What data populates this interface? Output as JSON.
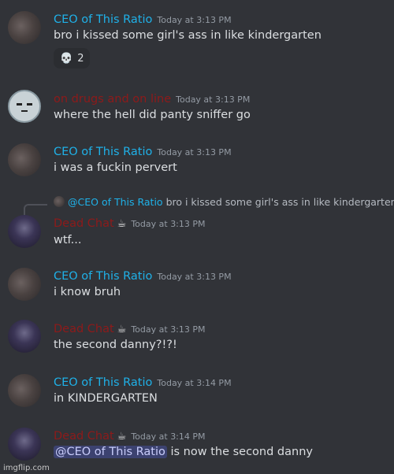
{
  "messages": [
    {
      "author": "CEO of This Ratio",
      "time": "Today at 3:13 PM",
      "text": "bro i kissed some girl's ass in like kindergarten",
      "reaction": {
        "emoji": "💀",
        "count": "2"
      }
    },
    {
      "author": "on drugs and on line",
      "time": "Today at 3:13 PM",
      "text": "where the hell did panty sniffer go"
    },
    {
      "author": "CEO of This Ratio",
      "time": "Today at 3:13 PM",
      "text": "i was a fuckin pervert"
    },
    {
      "author": "Dead Chat",
      "badge": "☕",
      "time": "Today at 3:13 PM",
      "text": "wtf...",
      "reply": {
        "author": "@CEO of This Ratio",
        "text": "bro i kissed some girl's ass in like kindergarten"
      }
    },
    {
      "author": "CEO of This Ratio",
      "time": "Today at 3:13 PM",
      "text": "i know bruh"
    },
    {
      "author": "Dead Chat",
      "badge": "☕",
      "time": "Today at 3:13 PM",
      "text": "the second danny?!?!"
    },
    {
      "author": "CEO of This Ratio",
      "time": "Today at 3:14 PM",
      "text": "in KINDERGARTEN"
    },
    {
      "author": "Dead Chat",
      "badge": "☕",
      "time": "Today at 3:14 PM",
      "mention": "@CEO of This Ratio",
      "text": " is now the second danny"
    }
  ],
  "watermark": "imgflip.com",
  "colors": {
    "background": "#313338",
    "ceo_name": "#1fb1e8",
    "dead_name": "#8e1a1a",
    "mention_bg": "#3c4270"
  }
}
